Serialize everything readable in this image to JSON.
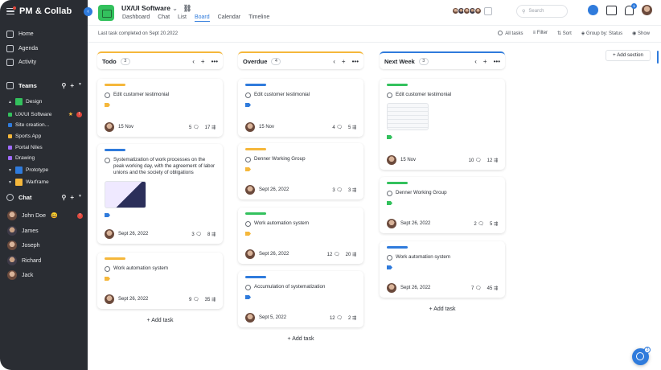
{
  "app": {
    "brand": "PM & Collab"
  },
  "sidebar": {
    "nav": [
      {
        "label": "Home"
      },
      {
        "label": "Agenda"
      },
      {
        "label": "Activity"
      }
    ],
    "teams_title": "Teams",
    "teams": [
      {
        "label": "Design",
        "color": "#33c15d"
      },
      {
        "label": "UX/UI Software",
        "color": "#33c15d",
        "badge": "!"
      },
      {
        "label": "Site creation...",
        "color": "#2f7bdc"
      },
      {
        "label": "Sports App",
        "color": "#f5b73b"
      },
      {
        "label": "Portal Niles",
        "color": "#a06bff"
      },
      {
        "label": "Drawing",
        "color": "#a06bff"
      },
      {
        "label": "Prototype",
        "color": "#2f7bdc"
      },
      {
        "label": "Warframe",
        "color": "#f5b73b"
      }
    ],
    "chat_title": "Chat",
    "chats": [
      {
        "label": "John Doe",
        "emoji": "😀",
        "badge": "!"
      },
      {
        "label": "James"
      },
      {
        "label": "Joseph"
      },
      {
        "label": "Richard"
      },
      {
        "label": "Jack"
      }
    ]
  },
  "header": {
    "project_title": "UX/UI Software",
    "project_suffix": "⌄",
    "tabs": [
      "Dashboard",
      "Chat",
      "List",
      "Board",
      "Calendar",
      "Timeline"
    ],
    "active_tab": "Board",
    "search_placeholder": "Search",
    "bell_count": "1"
  },
  "subbar": {
    "last_task": "Last task completed on Sept 20.2022",
    "all_tasks": "All tasks",
    "filter": "Filter",
    "sort": "Sort",
    "group_by": "Group by: Status",
    "show": "Show"
  },
  "columns": [
    {
      "name": "Todo",
      "count": "3",
      "accent": "#f5b73b",
      "cards": [
        {
          "pill": "#f5b73b",
          "title": "Edit customer testimonial",
          "tag": "#f5b73b",
          "date": "15 Nov",
          "comments": "5",
          "subtasks": "17"
        },
        {
          "pill": "#2f7bdc",
          "title": "Systematization of work processes on the peak working day, with the agreement of labor unions and the society of obligations",
          "tag": "#2f7bdc",
          "date": "Sept 26, 2022",
          "comments": "3",
          "subtasks": "8",
          "thumb": "purple"
        },
        {
          "pill": "#f5b73b",
          "title": "Work automation system",
          "tag": "#f5b73b",
          "date": "Sept 26, 2022",
          "comments": "9",
          "subtasks": "35"
        }
      ],
      "add_label": "Add task"
    },
    {
      "name": "Overdue",
      "count": "4",
      "accent": "#f5b73b",
      "cards": [
        {
          "pill": "#2f7bdc",
          "title": "Edit customer testimonial",
          "tag": "#2f7bdc",
          "date": "15 Nov",
          "comments": "4",
          "subtasks": "5"
        },
        {
          "pill": "#f5b73b",
          "title": "Denner Working Group",
          "tag": "#f5b73b",
          "date": "Sept 26, 2022",
          "comments": "3",
          "subtasks": "3"
        },
        {
          "pill": "#33c15d",
          "title": "Work automation system",
          "tag": "#f5b73b",
          "date": "Sept 26, 2022",
          "comments": "12",
          "subtasks": "20"
        },
        {
          "pill": "#2f7bdc",
          "title": "Accumulation of systematization",
          "tag": "#2f7bdc",
          "date": "Sept 5, 2022",
          "comments": "12",
          "subtasks": "2"
        }
      ],
      "add_label": "Add task"
    },
    {
      "name": "Next Week",
      "count": "3",
      "accent": "#2f7bdc",
      "cards": [
        {
          "pill": "#33c15d",
          "title": "Edit customer testimonial",
          "tag": "#33c15d",
          "date": "15 Nov",
          "comments": "10",
          "subtasks": "12",
          "thumb": "doc"
        },
        {
          "pill": "#33c15d",
          "title": "Denner Working Group",
          "tag": "#33c15d",
          "date": "Sept 26, 2022",
          "comments": "2",
          "subtasks": "5"
        },
        {
          "pill": "#2f7bdc",
          "title": "Work automation system",
          "tag": "#2f7bdc",
          "date": "Sept 26, 2022",
          "comments": "7",
          "subtasks": "45"
        }
      ],
      "add_label": "Add task"
    }
  ],
  "add_section_label": "Add section",
  "help_count": "3"
}
